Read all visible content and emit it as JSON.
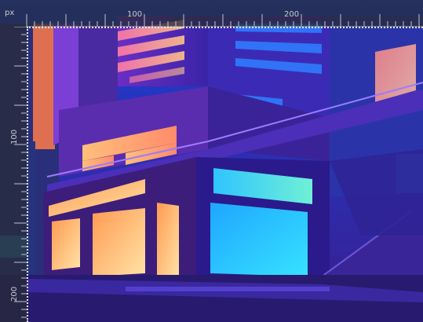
{
  "ruler": {
    "unit_label": "px",
    "horizontal_ticks": [
      "100",
      "200"
    ],
    "vertical_ticks": [
      "100",
      "200"
    ]
  },
  "artwork": {
    "subject": "neon-city-building-illustration",
    "colors": {
      "sky": "#2a3bd8",
      "building_dark": "#3a1f8c",
      "building_mid": "#5b2bb8",
      "window_warm": "#ffb36b",
      "window_glow": "#ffe1a8",
      "window_cyan": "#2fd6ff",
      "pink_glow": "#ff6fa8",
      "ruler_bg": "#282c3a",
      "ruler_text": "#c9ccd4"
    }
  }
}
